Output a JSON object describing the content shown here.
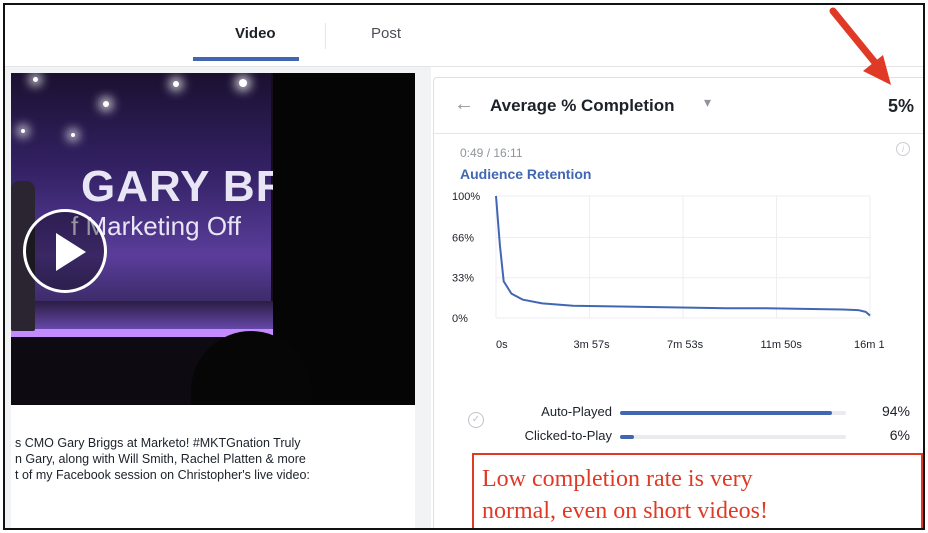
{
  "tabs": [
    {
      "label": "Video",
      "active": true
    },
    {
      "label": "Post",
      "active": false
    }
  ],
  "video": {
    "banner_name": "GARY BR",
    "banner_subtitle": "f Marketing Off"
  },
  "post_caption": [
    "s CMO Gary Briggs at Marketo! #MKTGnation Truly",
    "n Gary, along with Will Smith, Rachel Platten & more",
    "t of my Facebook session on Christopher's live video:"
  ],
  "metric": {
    "back_icon": "back-arrow-icon",
    "title": "Average % Completion",
    "caret": "▾",
    "value": "5%"
  },
  "time_readout": "0:49 / 16:11",
  "retention_title": "Audience Retention",
  "chart_data": {
    "type": "line",
    "title": "Audience Retention",
    "x_tick_labels": [
      "0s",
      "3m 57s",
      "7m 53s",
      "11m 50s",
      "16m 1"
    ],
    "y_tick_labels": [
      "100%",
      "66%",
      "33%",
      "0%"
    ],
    "ylim": [
      0,
      100
    ],
    "xlim": [
      0,
      971
    ],
    "grid": true,
    "series": [
      {
        "color": "#4267b2",
        "x": [
          0,
          10,
          20,
          40,
          70,
          120,
          200,
          300,
          400,
          500,
          600,
          700,
          800,
          900,
          940,
          960,
          971
        ],
        "y": [
          100,
          60,
          30,
          20,
          15,
          12,
          10,
          9.5,
          9,
          8.5,
          8,
          8,
          7.5,
          7,
          6.5,
          5,
          2
        ]
      }
    ]
  },
  "play_breakdown": [
    {
      "label": "Auto-Played",
      "value": 94,
      "display": "94%"
    },
    {
      "label": "Clicked-to-Play",
      "value": 6,
      "display": "6%"
    }
  ],
  "annotation": {
    "lines": [
      "Low completion rate is very",
      "normal, even on short videos!"
    ],
    "color": "#e03a26"
  },
  "colors": {
    "accent": "#4267b2",
    "annotation_red": "#e03a26"
  }
}
